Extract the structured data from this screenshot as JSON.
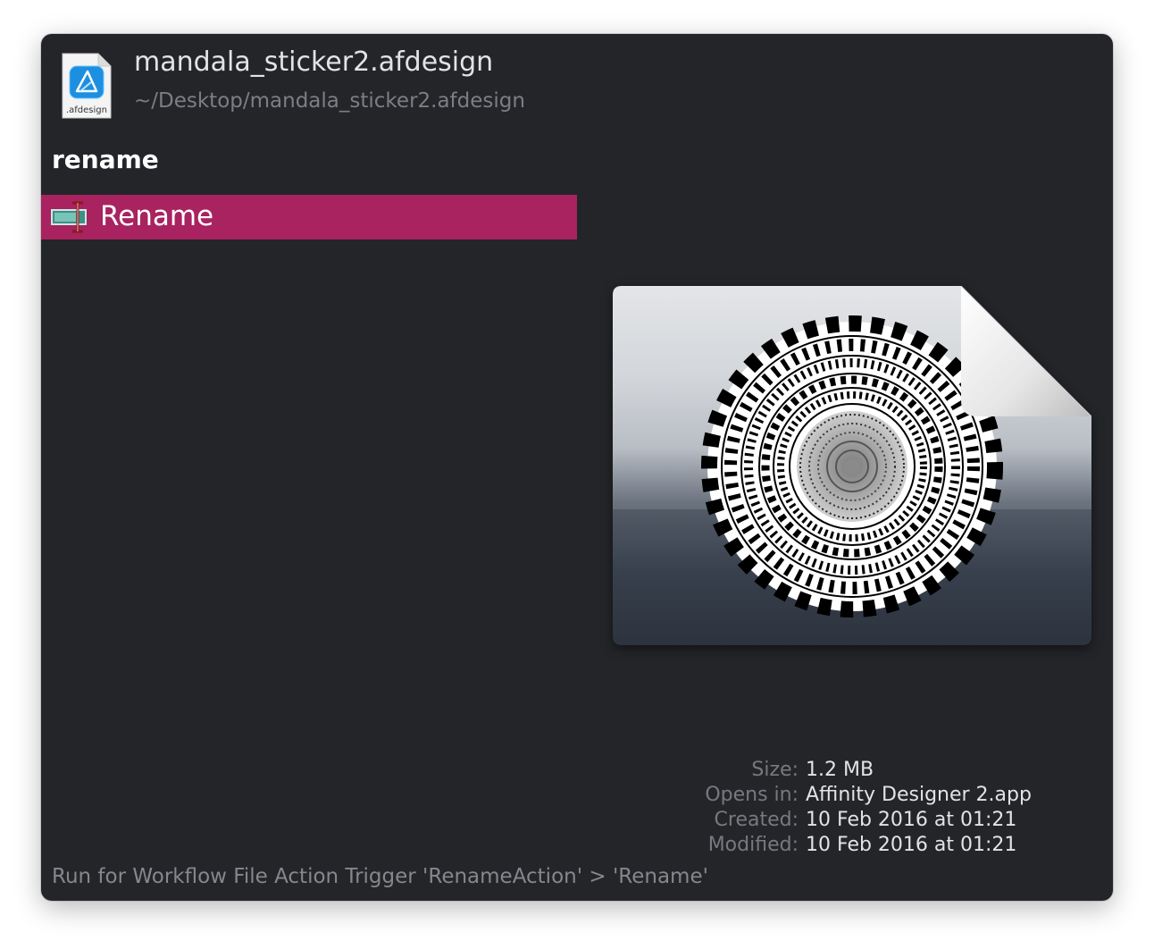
{
  "header": {
    "title": "mandala_sticker2.afdesign",
    "path": "~/Desktop/mandala_sticker2.afdesign",
    "file_icon_label": ".afdesign"
  },
  "query": "rename",
  "results": [
    {
      "label": "Rename",
      "icon": "rename-icon",
      "selected": true
    }
  ],
  "info": [
    {
      "label": "Size:",
      "value": "1.2 MB"
    },
    {
      "label": "Opens in:",
      "value": "Affinity Designer 2.app"
    },
    {
      "label": "Created:",
      "value": "10 Feb 2016 at 01:21"
    },
    {
      "label": "Modified:",
      "value": "10 Feb 2016 at 01:21"
    }
  ],
  "status": "Run for Workflow File Action Trigger 'RenameAction' > 'Rename'",
  "colors": {
    "background": "#232529",
    "selection": "#a82360",
    "secondary_text": "#7c7e83"
  }
}
